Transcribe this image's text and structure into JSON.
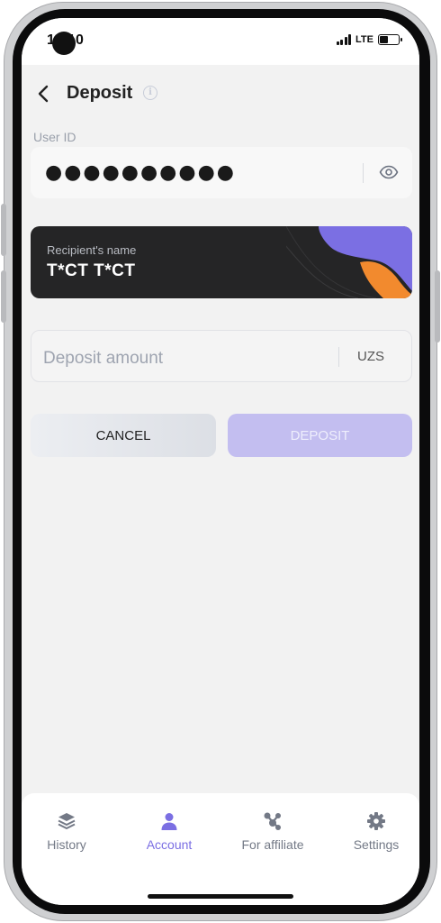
{
  "status_bar": {
    "time": "10:10",
    "network": "LTE",
    "battery_level": 0.45
  },
  "header": {
    "title": "Deposit",
    "info_glyph": "i"
  },
  "user_id": {
    "label": "User ID",
    "masked_value": "●●●●●●●●●●"
  },
  "recipient": {
    "label": "Recipient's name",
    "name": "T*CT T*CT"
  },
  "amount": {
    "placeholder": "Deposit amount",
    "currency": "UZS"
  },
  "buttons": {
    "cancel": "CANCEL",
    "deposit": "DEPOSIT"
  },
  "nav": {
    "items": [
      {
        "label": "History",
        "icon": "layers-icon"
      },
      {
        "label": "Account",
        "icon": "person-icon"
      },
      {
        "label": "For affiliate",
        "icon": "network-icon"
      },
      {
        "label": "Settings",
        "icon": "gear-icon"
      }
    ],
    "active_label": "Account"
  },
  "colors": {
    "accent": "#7b6fe3",
    "deposit_disabled": "#c3bef0",
    "card_background": "#252526",
    "card_orange": "#f28a2e",
    "background": "#f2f2f2"
  }
}
